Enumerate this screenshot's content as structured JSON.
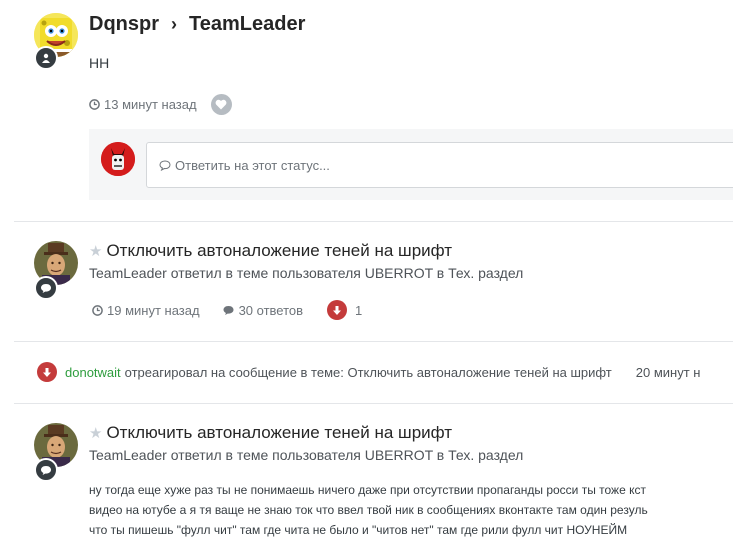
{
  "status": {
    "author": "Dqnspr",
    "target": "TeamLeader",
    "text": "НН",
    "time": "13 минут назад",
    "reply_placeholder": "Ответить на этот статус..."
  },
  "posts": [
    {
      "topic": "Отключить автоналожение теней на шрифт",
      "subline": "TeamLeader ответил в теме пользователя UBERROT в Тех. раздел",
      "time": "19 минут назад",
      "replies": "30 ответов",
      "reactions": "1"
    },
    {
      "topic": "Отключить автоналожение теней на шрифт",
      "subline": "TeamLeader ответил в теме пользователя UBERROT в Тех. раздел",
      "body": [
        "ну тогда еще хуже раз ты не понимаешь ничего даже при отсутствии пропаганды росси ты тоже кст",
        "видео на ютубе а я тя ваще не знаю ток что ввел твой ник в сообщениях вконтакте там один резуль",
        "что ты пишешь \"фулл чит\" там где чита не было и \"читов нет\" там где рили фулл чит НОУНЕЙМ"
      ]
    }
  ],
  "reaction_event": {
    "user": "donotwait",
    "text": "отреагировал на сообщение в теме: Отключить автоналожение теней на шрифт",
    "time": "20 минут н"
  },
  "colors": {
    "accent_green": "#2e9d3e",
    "downvote_red": "#c43b3b",
    "badge_dark": "#353c41"
  }
}
